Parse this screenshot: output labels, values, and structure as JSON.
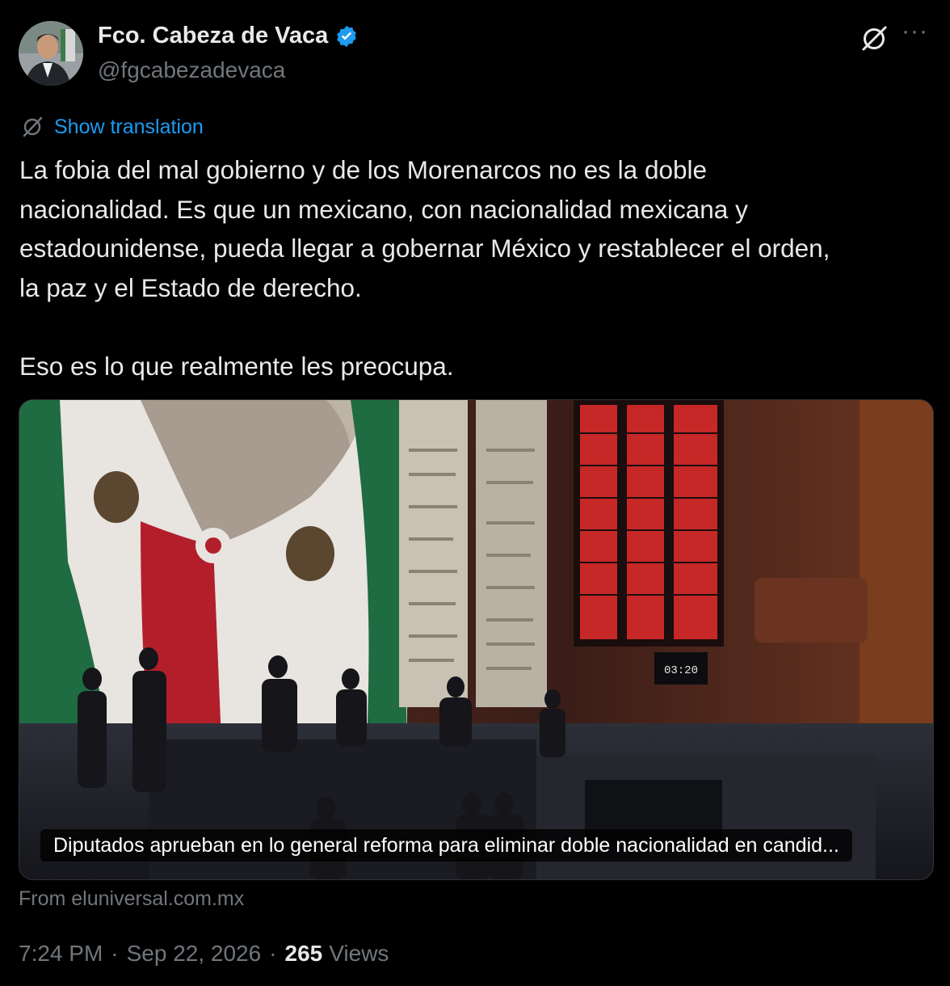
{
  "author": {
    "name": "Fco. Cabeza de Vaca",
    "handle": "@fgcabezadevaca",
    "verified": true,
    "avatar_icon": "profile-photo"
  },
  "header_actions": {
    "grok_icon": "grok-icon",
    "more_icon": "more-horizontal-icon",
    "more_label": "···"
  },
  "translation": {
    "icon": "translate-icon",
    "label": "Show translation"
  },
  "tweet": {
    "text": "La fobia del mal gobierno y de los Morenarcos no es la doble\nnacionalidad. Es que un mexicano, con nacionalidad mexicana y\nestadounidense, pueda llegar a gobernar México y restablecer el orden,\nla paz y el Estado de derecho.\n\nEso es lo que realmente les preocupa."
  },
  "card": {
    "caption": "Diputados aprueban en lo general reforma para eliminar doble nacionalidad en candid...",
    "source": "From eluniversal.com.mx",
    "image_clock": "03:20"
  },
  "meta": {
    "time": "7:24 PM",
    "date": "Sep 22, 2026",
    "separator": "·",
    "views_count": "265",
    "views_label": "Views"
  },
  "colors": {
    "background": "#000000",
    "text": "#e7e9ea",
    "secondary": "#71767b",
    "link": "#1d9bf0",
    "verified": "#1d9bf0",
    "border": "#2f3336"
  }
}
